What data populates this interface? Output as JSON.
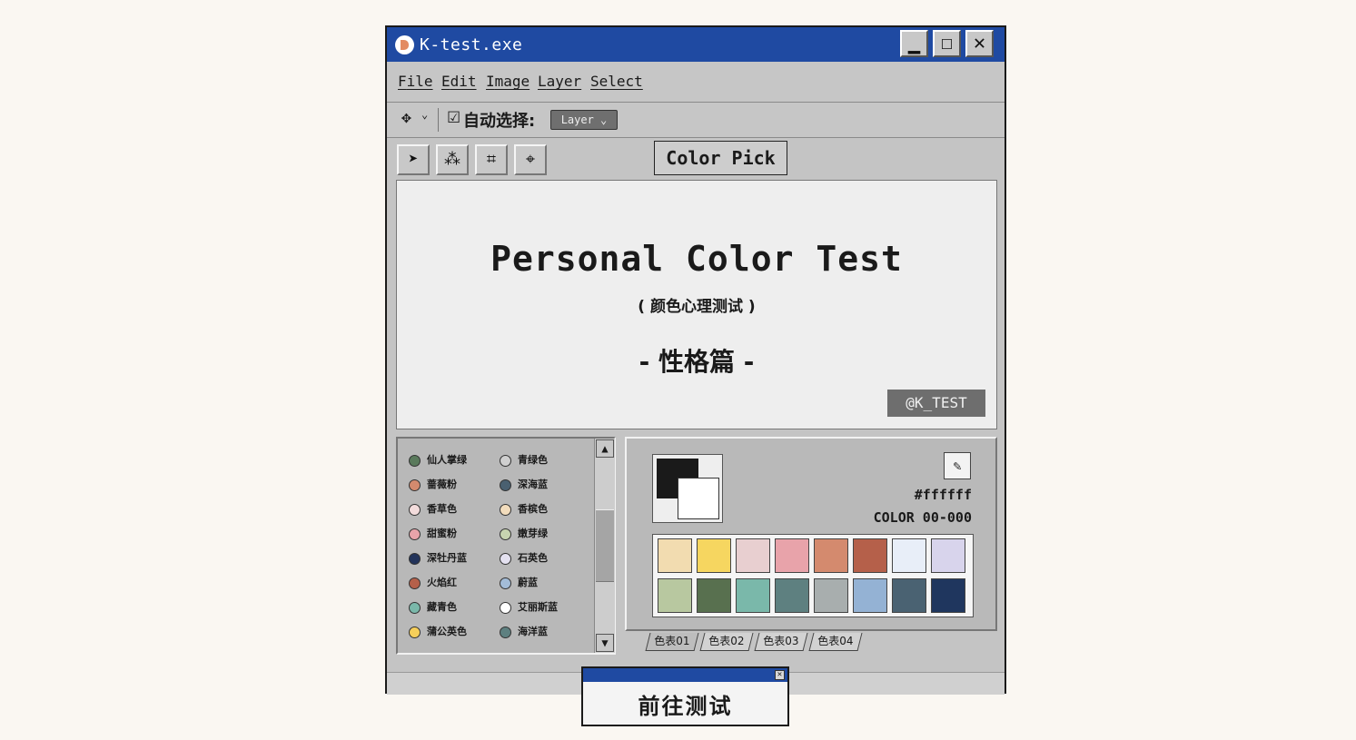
{
  "window": {
    "title": "K-test.exe",
    "minimize": "▁",
    "maximize": "☐",
    "close": "✕"
  },
  "menu": [
    {
      "first": "F",
      "rest": "ile"
    },
    {
      "first": "E",
      "rest": "dit"
    },
    {
      "first": "I",
      "rest": "mage"
    },
    {
      "first": "L",
      "rest": "ayer"
    },
    {
      "first": "S",
      "rest": "elect"
    }
  ],
  "toolbar": {
    "move_icon": "✥",
    "chevron": "⌄",
    "auto_select_label": "自动选择:",
    "layer_dropdown": "Layer ⌄",
    "checkbox": "☑"
  },
  "tools": [
    {
      "name": "arrow-tool-icon",
      "glyph": "➤"
    },
    {
      "name": "magic-wand-icon",
      "glyph": "⁂"
    },
    {
      "name": "crop-icon",
      "glyph": "⌗"
    },
    {
      "name": "crosshair-icon",
      "glyph": "⌖"
    }
  ],
  "color_pick": {
    "label": "Color Pick",
    "checkbox": "☑"
  },
  "canvas": {
    "title": "Personal Color Test",
    "subtitle": "( 颜色心理测试 )",
    "chapter": "- 性格篇 -",
    "tag": "@K_TEST"
  },
  "color_list": [
    {
      "name": "仙人掌绿",
      "color": "#5a7a5c"
    },
    {
      "name": "青绿色",
      "color": "#cfcfcf"
    },
    {
      "name": "蔷薇粉",
      "color": "#d48a6e"
    },
    {
      "name": "深海蓝",
      "color": "#4a6070"
    },
    {
      "name": "香草色",
      "color": "#f3dcdc"
    },
    {
      "name": "香槟色",
      "color": "#f2dcbc"
    },
    {
      "name": "甜蜜粉",
      "color": "#e8a3aa"
    },
    {
      "name": "嫩芽绿",
      "color": "#c7d4b0"
    },
    {
      "name": "深牡丹蓝",
      "color": "#22335a"
    },
    {
      "name": "石英色",
      "color": "#e4e1f0"
    },
    {
      "name": "火焰红",
      "color": "#b5604a"
    },
    {
      "name": "蔚蓝",
      "color": "#a3bcd8"
    },
    {
      "name": "藏青色",
      "color": "#7ab8aa"
    },
    {
      "name": "艾丽斯蓝",
      "color": "#ffffff"
    },
    {
      "name": "蒲公英色",
      "color": "#f6cf5a"
    },
    {
      "name": "海洋蓝",
      "color": "#5e8080"
    }
  ],
  "picker": {
    "hex": "#ffffff",
    "code": "COLOR 00-000",
    "eyedropper": "✎"
  },
  "palette": [
    "#f2dcb0",
    "#f6d660",
    "#e8cfd0",
    "#e8a3aa",
    "#d48a6e",
    "#b5604a",
    "#e8eef8",
    "#d8d4ec",
    "#b8c8a0",
    "#58704f",
    "#7ab8aa",
    "#5e8080",
    "#a8aeae",
    "#94b2d4",
    "#4a6272",
    "#1f365e"
  ],
  "tabs": [
    "色表01",
    "色表02",
    "色表03",
    "色表04"
  ],
  "go": {
    "label": "前往测试",
    "close": "✕"
  },
  "scroll": {
    "up": "▲",
    "down": "▼"
  }
}
